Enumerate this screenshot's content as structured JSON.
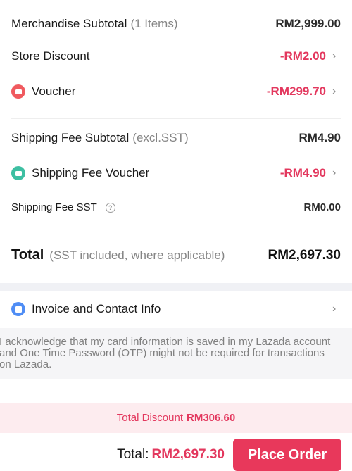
{
  "summary": {
    "merchandise": {
      "label": "Merchandise Subtotal",
      "count": "(1 Items)",
      "value": "RM2,999.00"
    },
    "store_discount": {
      "label": "Store Discount",
      "value": "-RM2.00"
    },
    "voucher": {
      "label": "Voucher",
      "value": "-RM299.70",
      "icon": "voucher-icon",
      "icon_color": "#f05a5f"
    },
    "shipping_subtotal": {
      "label": "Shipping Fee Subtotal",
      "note": "(excl.SST)",
      "value": "RM4.90"
    },
    "shipping_voucher": {
      "label": "Shipping Fee Voucher",
      "value": "-RM4.90",
      "icon": "shipping-voucher-icon",
      "icon_color": "#3dbfa2"
    },
    "shipping_sst": {
      "label": "Shipping Fee SST",
      "help": "?",
      "value": "RM0.00"
    },
    "total": {
      "label": "Total",
      "note": "(SST included, where applicable)",
      "value": "RM2,697.30"
    }
  },
  "invoice": {
    "label": "Invoice and Contact Info",
    "icon": "invoice-icon",
    "icon_color": "#4f8df5"
  },
  "acknowledgement": "I acknowledge that my card information is saved in my Lazada account and One Time Password (OTP) might not be required for transactions on Lazada.",
  "discount_bar": {
    "label": "Total Discount",
    "value": "RM306.60"
  },
  "footer": {
    "total_label": "Total:",
    "total_value": "RM2,697.30",
    "button_label": "Place Order"
  },
  "colors": {
    "accent": "#e8385b",
    "discount_text": "#e3385e",
    "discount_bg": "#fdecef"
  },
  "chevron": "›"
}
